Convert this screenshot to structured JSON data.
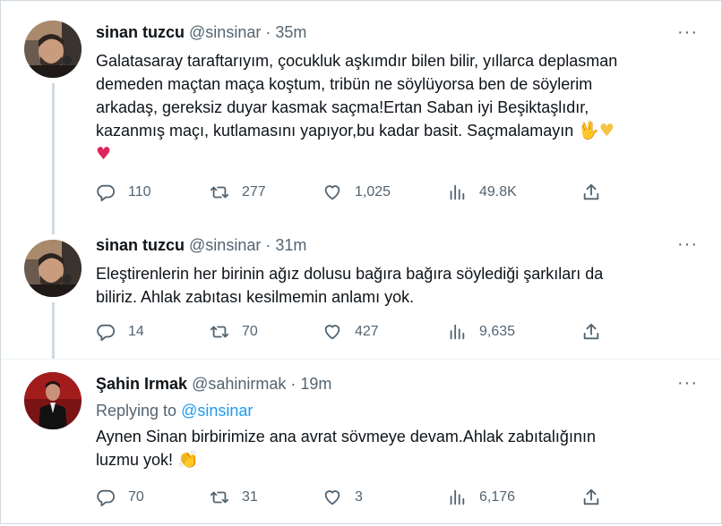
{
  "tweets": [
    {
      "name": "sinan tuzcu",
      "handle": "@sinsinar",
      "dot": "·",
      "time": "35m",
      "more": "···",
      "lines": [
        "Galatasaray taraftarıyım, çocukluk aşkımdır bilen bilir, yıllarca deplasman",
        "demeden maçtan maça koştum, tribün ne söylüyorsa ben de söylerim",
        "arkadaş, gereksiz duyar kasmak saçma!Ertan Saban iyi Beşiktaşlıdır,",
        "kazanmış maçı, kutlamasını yapıyor,bu kadar basit. Saçmalamayın"
      ],
      "emoji_end": "🖖",
      "emoji_heart_yellow": "♥",
      "emoji_heart_red": "♥",
      "replies": "110",
      "retweets": "277",
      "likes": "1,025",
      "views": "49.8K"
    },
    {
      "name": "sinan tuzcu",
      "handle": "@sinsinar",
      "dot": "·",
      "time": "31m",
      "more": "···",
      "lines": [
        "Eleştirenlerin her birinin ağız dolusu bağıra bağıra söylediği şarkıları da",
        "biliriz. Ahlak zabıtası kesilmemin anlamı yok."
      ],
      "replies": "14",
      "retweets": "70",
      "likes": "427",
      "views": "9,635"
    },
    {
      "name": "Şahin Irmak",
      "handle": "@sahinirmak",
      "dot": "·",
      "time": "19m",
      "more": "···",
      "replying_prefix": "Replying to ",
      "replying_to": "@sinsinar",
      "lines": [
        "Aynen Sinan birbirimize ana avrat sövmeye devam.Ahlak zabıtalığının",
        "luzmu yok!"
      ],
      "emoji_clap": "👏",
      "replies": "70",
      "retweets": "31",
      "likes": "3",
      "views": "6,176"
    }
  ],
  "icons": {
    "reply": "reply-icon",
    "retweet": "retweet-icon",
    "like": "heart-icon",
    "views": "views-icon",
    "share": "share-icon",
    "more": "more-icon"
  },
  "colors": {
    "text": "#0f1419",
    "secondary": "#536471",
    "link": "#1d9bf0",
    "border": "#cfd9de"
  }
}
